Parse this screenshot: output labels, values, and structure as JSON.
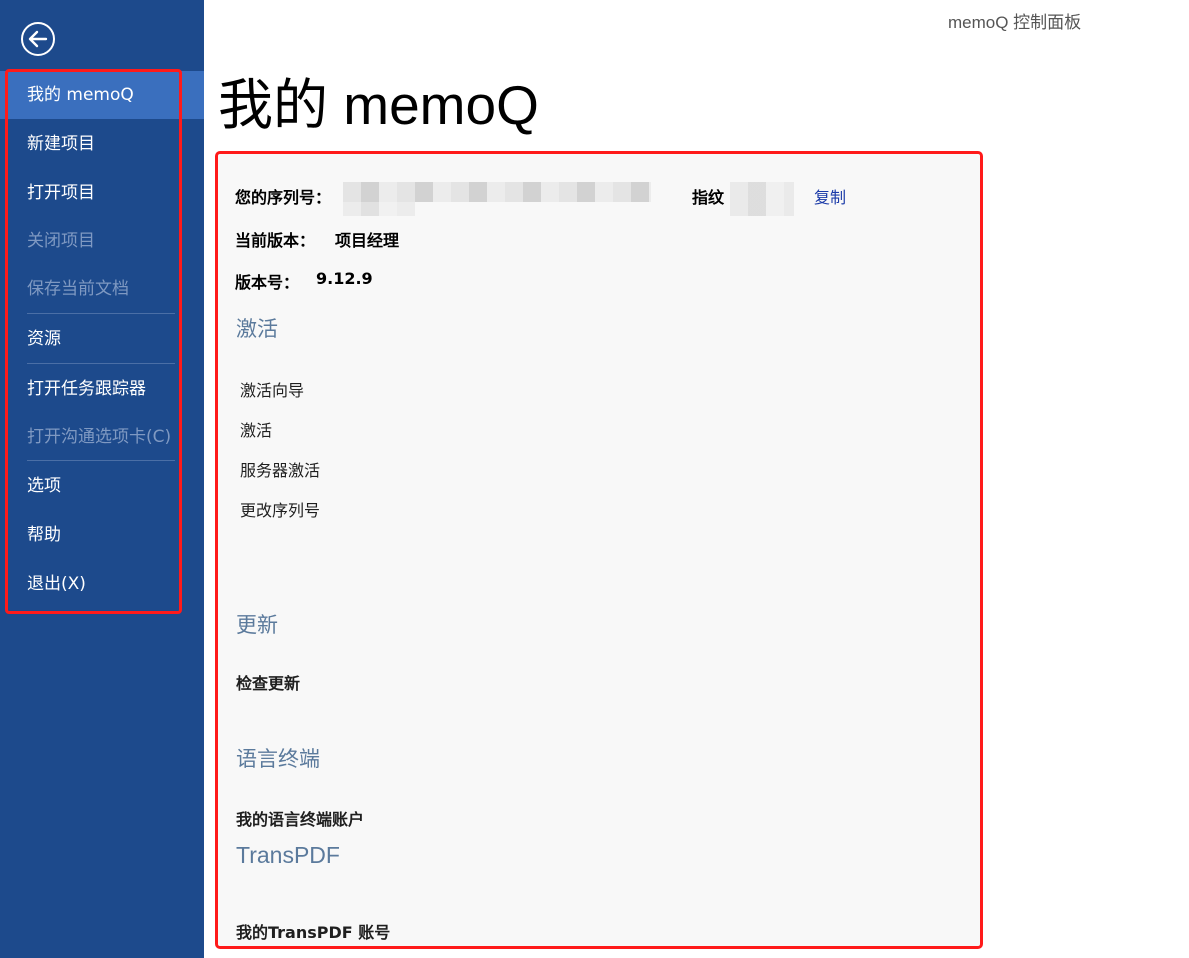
{
  "window": {
    "title": "memoQ 控制面板"
  },
  "page": {
    "title": "我的 memoQ"
  },
  "sidebar": {
    "items": [
      {
        "label": "我的 memoQ"
      },
      {
        "label": "新建项目"
      },
      {
        "label": "打开项目"
      },
      {
        "label": "关闭项目"
      },
      {
        "label": "保存当前文档"
      },
      {
        "label": "资源"
      },
      {
        "label": "打开任务跟踪器"
      },
      {
        "label": "打开沟通选项卡(C)"
      },
      {
        "label": "选项"
      },
      {
        "label": "帮助"
      },
      {
        "label": "退出(X)"
      }
    ]
  },
  "info": {
    "serial_label": "您的序列号：",
    "fingerprint_label": "指纹",
    "copy_label": "复制",
    "edition_label": "当前版本：",
    "edition_value": "项目经理",
    "version_label": "版本号：",
    "version_value": "9.12.9"
  },
  "activation": {
    "heading": "激活",
    "items": [
      "激活向导",
      "激活",
      "服务器激活",
      "更改序列号"
    ]
  },
  "update": {
    "heading": "更新",
    "check": "检查更新"
  },
  "language_terminal": {
    "heading": "语言终端",
    "account": "我的语言终端账户"
  },
  "transpdf": {
    "heading": "TransPDF",
    "account": "我的TransPDF 账号"
  },
  "colors": {
    "sidebar_bg": "#1d4a8c",
    "sidebar_active": "#3a6fbe",
    "highlight_border": "#ff1a1a",
    "section_heading": "#5b7a9c",
    "link": "#1a3aa8"
  }
}
